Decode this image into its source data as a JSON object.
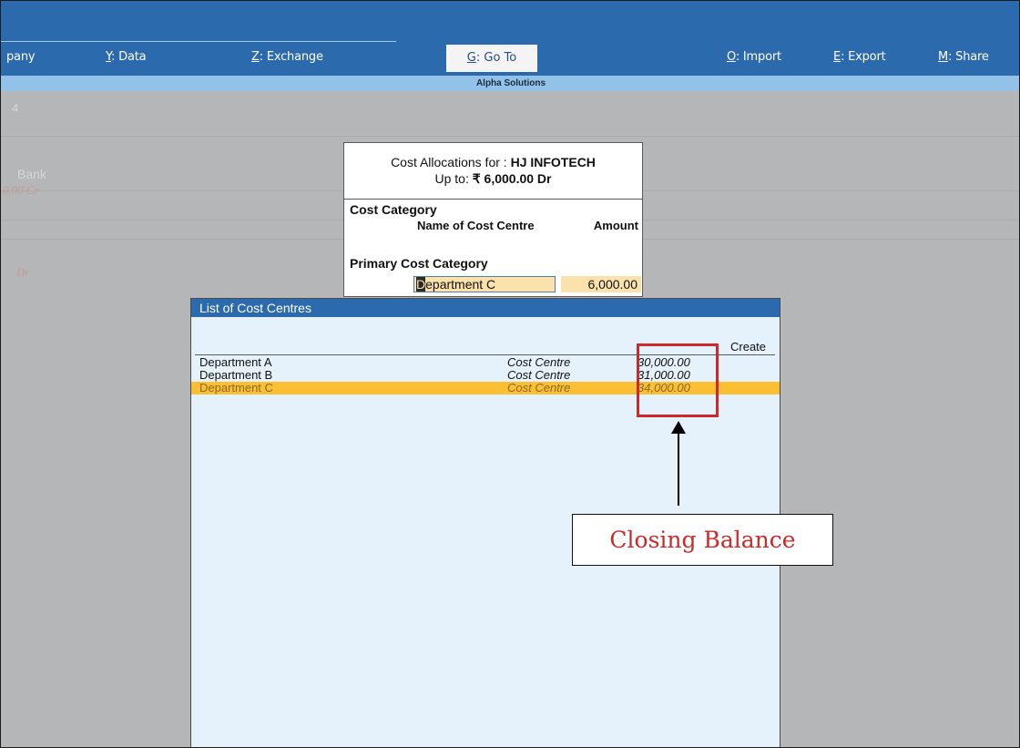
{
  "menu": {
    "company": "pany",
    "data_key": "Y",
    "data_label": ": Data",
    "exchange_key": "Z",
    "exchange_label": ": Exchange",
    "goto_key": "G",
    "goto_label": ": Go To",
    "import_key": "O",
    "import_label": ": Import",
    "export_key": "E",
    "export_label": ": Export",
    "share_key": "M",
    "share_label": ": Share"
  },
  "company_name": "Alpha Solutions",
  "background": {
    "t1": "4",
    "t2": "Bank",
    "t3": "0.00 Cr",
    "t4": "Dr"
  },
  "allocation": {
    "label": "Cost Allocations for : ",
    "party": "HJ INFOTECH",
    "upto_label": "Up to: ",
    "upto_value": "₹ 6,000.00 Dr",
    "cost_category_header": "Cost Category",
    "name_col": "Name of Cost Centre",
    "amount_col": "Amount",
    "category": "Primary Cost Category",
    "input_first_char": "D",
    "input_rest": "epartment C",
    "amount": "6,000.00"
  },
  "list": {
    "title": "List of Cost Centres",
    "create": "Create",
    "rows": [
      {
        "name": "Department A",
        "type": "Cost Centre",
        "balance": "30,000.00"
      },
      {
        "name": "Department B",
        "type": "Cost Centre",
        "balance": "31,000.00"
      },
      {
        "name": "Department C",
        "type": "Cost Centre",
        "balance": "34,000.00"
      }
    ],
    "selected_index": 2
  },
  "annotation": {
    "label": "Closing Balance",
    "color": "#cc2a2a"
  }
}
